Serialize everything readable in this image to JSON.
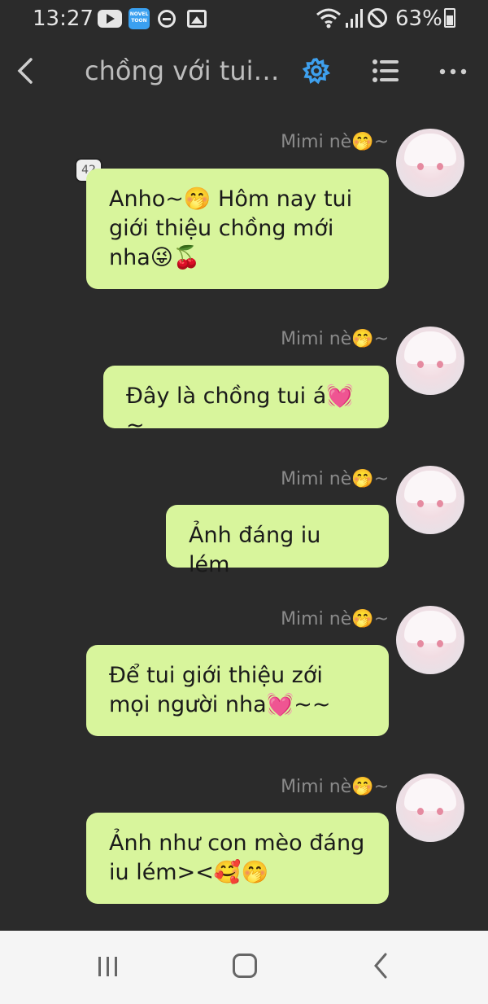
{
  "status_bar": {
    "time": "13:27",
    "battery": "63%",
    "icons": [
      "youtube-icon",
      "noveltoon-icon",
      "do-not-disturb-icon",
      "gallery-icon",
      "wifi-icon",
      "signal-icon",
      "no-sim-icon",
      "battery-icon"
    ],
    "noveltoon_text": "NOVEL TOON"
  },
  "header": {
    "title": "chồng với tui đ...",
    "icons": [
      "back-icon",
      "gear-icon",
      "list-icon",
      "more-icon"
    ],
    "accent_color": "#3ea0ee"
  },
  "messages": [
    {
      "sender": "Mimi nè🤭~",
      "text": "Anho~🤭 Hôm nay tui giới thiệu chồng mới nha😜🍒",
      "badge": "42"
    },
    {
      "sender": "Mimi nè🤭~",
      "text": "Đây là chồng tui á💓~"
    },
    {
      "sender": "Mimi nè🤭~",
      "text": "Ảnh đáng iu lém"
    },
    {
      "sender": "Mimi nè🤭~",
      "text": "Để tui giới thiệu zới mọi người nha💓~~"
    },
    {
      "sender": "Mimi nè🤭~",
      "text": "Ảnh như con mèo đáng iu lém><🥰🤭"
    }
  ],
  "bubble_color": "#d8f59c",
  "nav": {
    "icons": [
      "recent-apps-icon",
      "home-icon",
      "nav-back-icon"
    ]
  }
}
